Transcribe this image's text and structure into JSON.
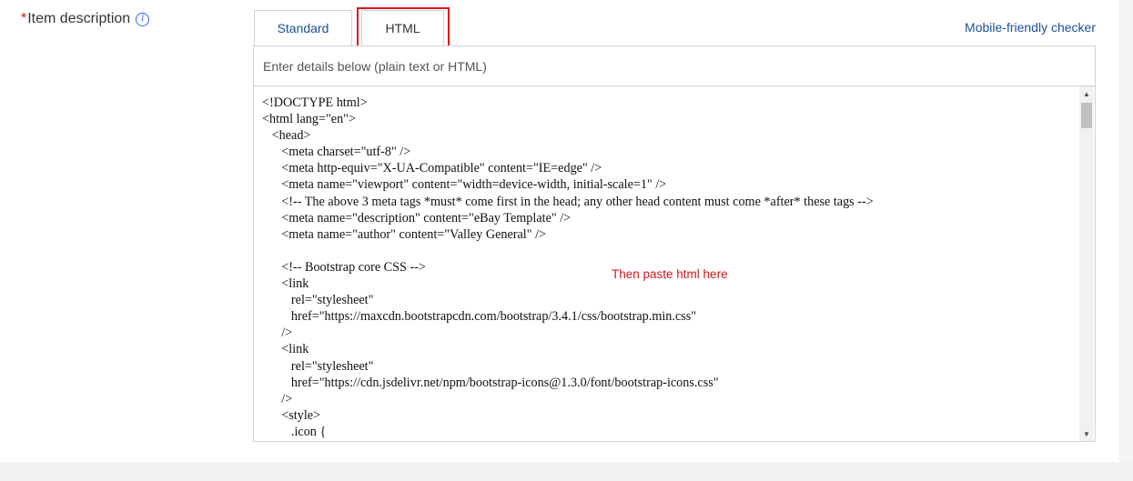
{
  "field": {
    "required_mark": "*",
    "label": "Item description",
    "info_icon": "info-circle-icon"
  },
  "tabs": {
    "standard": "Standard",
    "html": "HTML",
    "active": "HTML"
  },
  "mobile_checker": "Mobile-friendly checker",
  "editor": {
    "instructions": "Enter details below (plain text or HTML)",
    "content": "<!DOCTYPE html>\n<html lang=\"en\">\n   <head>\n      <meta charset=\"utf-8\" />\n      <meta http-equiv=\"X-UA-Compatible\" content=\"IE=edge\" />\n      <meta name=\"viewport\" content=\"width=device-width, initial-scale=1\" />\n      <!-- The above 3 meta tags *must* come first in the head; any other head content must come *after* these tags -->\n      <meta name=\"description\" content=\"eBay Template\" />\n      <meta name=\"author\" content=\"Valley General\" />\n\n      <!-- Bootstrap core CSS -->\n      <link\n         rel=\"stylesheet\"\n         href=\"https://maxcdn.bootstrapcdn.com/bootstrap/3.4.1/css/bootstrap.min.css\"\n      />\n      <link\n         rel=\"stylesheet\"\n         href=\"https://cdn.jsdelivr.net/npm/bootstrap-icons@1.3.0/font/bootstrap-icons.css\"\n      />\n      <style>\n         .icon {"
  },
  "annotation": "Then paste html here",
  "colors": {
    "link": "#1a5199",
    "required": "#e0101c",
    "highlight": "#e0101c",
    "annotation": "#d0191e"
  }
}
